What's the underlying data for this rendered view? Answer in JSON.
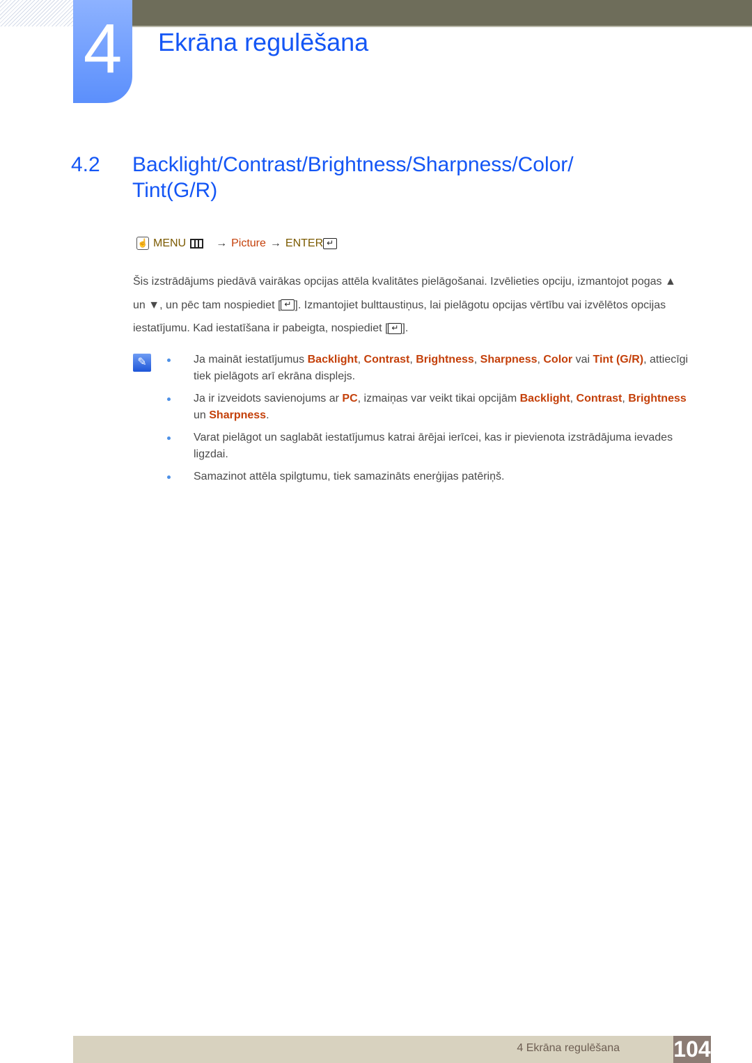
{
  "header": {
    "chapter_number": "4",
    "chapter_title": "Ekrāna regulēšana"
  },
  "section": {
    "number": "4.2",
    "title": "Backlight/Contrast/Brightness/Sharpness/Color/ Tint(G/R)"
  },
  "menu_path": {
    "menu": "MENU",
    "arrow": "→",
    "picture": "Picture",
    "enter": "ENTER"
  },
  "intro": {
    "part1": "Šis izstrādājums piedāvā vairākas opcijas attēla kvalitātes pielāgošanai. Izvēlieties opciju, izmantojot pogas ▲ un ▼, un pēc tam nospiediet [",
    "part2": "]. Izmantojiet bulttaustiņus, lai pielāgotu opcijas vērtību vai izvēlētos opcijas iestatījumu. Kad iestatīšana ir pabeigta, nospiediet [",
    "part3": "]."
  },
  "notes": {
    "note1": {
      "t1": "Ja maināt iestatījumus ",
      "k1": "Backlight",
      "s1": ", ",
      "k2": "Contrast",
      "s2": ", ",
      "k3": "Brightness",
      "s3": ", ",
      "k4": "Sharpness",
      "s4": ", ",
      "k5": "Color",
      "s5": " vai ",
      "k6": "Tint (G/R)",
      "t2": ", attiecīgi tiek pielāgots arī ekrāna displejs."
    },
    "note2": {
      "t1": "Ja ir izveidots savienojums ar ",
      "k1": "PC",
      "t2": ", izmaiņas var veikt tikai opcijām ",
      "k2": "Backlight",
      "s2": ", ",
      "k3": "Contrast",
      "s3": ", ",
      "k4": "Brightness",
      "s4": " un ",
      "k5": "Sharpness",
      "t3": "."
    },
    "note3": "Varat pielāgot un saglabāt iestatījumus katrai ārējai ierīcei, kas ir pievienota izstrādājuma ievades ligzdai.",
    "note4": "Samazinot attēla spilgtumu, tiek samazināts enerģijas patēriņš."
  },
  "footer": {
    "chapter_label": "4 Ekrāna regulēšana",
    "page_number": "104"
  }
}
